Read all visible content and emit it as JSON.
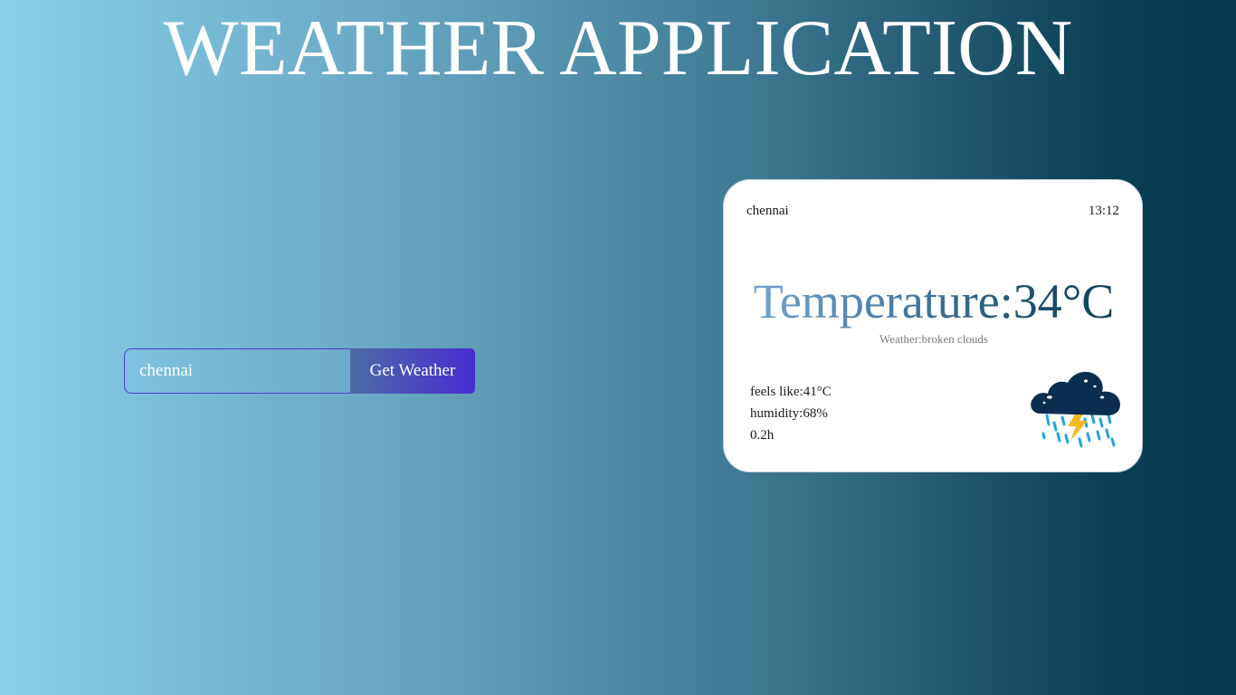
{
  "header": {
    "title": "WEATHER APPLICATION"
  },
  "search": {
    "value": "chennai",
    "placeholder": "",
    "button_label": "Get Weather"
  },
  "card": {
    "city": "chennai",
    "time": "13:12",
    "temperature": "Temperature:34°C",
    "condition": "Weather:broken clouds",
    "feels_like": "feels like:41°C",
    "humidity": "humidity:68%",
    "rain": "0.2h",
    "icon": "thunderstorm-rain-icon"
  },
  "colors": {
    "accent_button": "#4a2ed2",
    "cloud": "#0b2d4f",
    "lightning": "#f5b921",
    "rain": "#23a4dc"
  }
}
